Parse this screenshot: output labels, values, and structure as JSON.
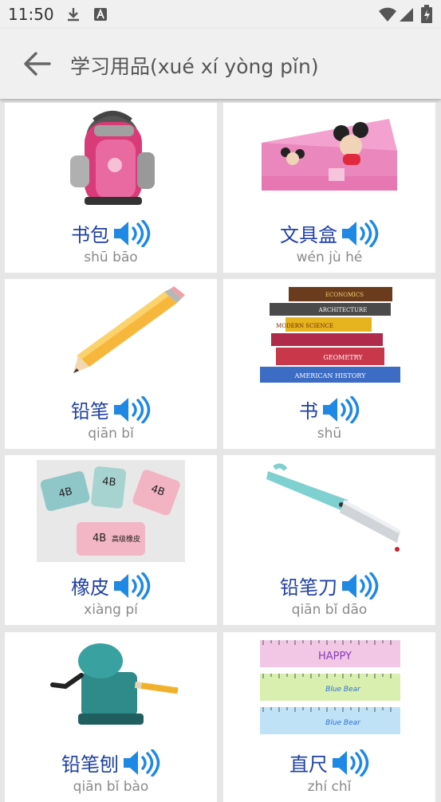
{
  "status": {
    "time": "11:50"
  },
  "header": {
    "title": "学习用品(xué xí yòng pǐn)"
  },
  "items": [
    {
      "name": "书包",
      "pinyin": "shū bāo",
      "icon": "backpack-image"
    },
    {
      "name": "文具盒",
      "pinyin": "wén jù hé",
      "icon": "pencil-case-image"
    },
    {
      "name": "铅笔",
      "pinyin": "qiān bǐ",
      "icon": "pencil-image"
    },
    {
      "name": "书",
      "pinyin": "shū",
      "icon": "books-image"
    },
    {
      "name": "橡皮",
      "pinyin": "xiàng pí",
      "icon": "eraser-image"
    },
    {
      "name": "铅笔刀",
      "pinyin": "qiān bǐ dāo",
      "icon": "pencil-knife-image"
    },
    {
      "name": "铅笔刨",
      "pinyin": "qiān bǐ bào",
      "icon": "pencil-sharpener-image"
    },
    {
      "name": "直尺",
      "pinyin": "zhí chǐ",
      "icon": "ruler-image"
    }
  ],
  "image_text": {
    "books": [
      "ECONOMICS",
      "ARCHITECTURE",
      "MODERN SCIENCE",
      "GEOMETRY",
      "AMERICAN HISTORY"
    ],
    "eraser": "4B",
    "eraser_cn": "高级橡皮",
    "ruler_labels": [
      "HAPPY",
      "Blue Bear",
      "Blue Bear"
    ]
  },
  "colors": {
    "accent": "#1f3fa4",
    "speaker": "#1e88e5",
    "background": "#e6e6e6"
  }
}
